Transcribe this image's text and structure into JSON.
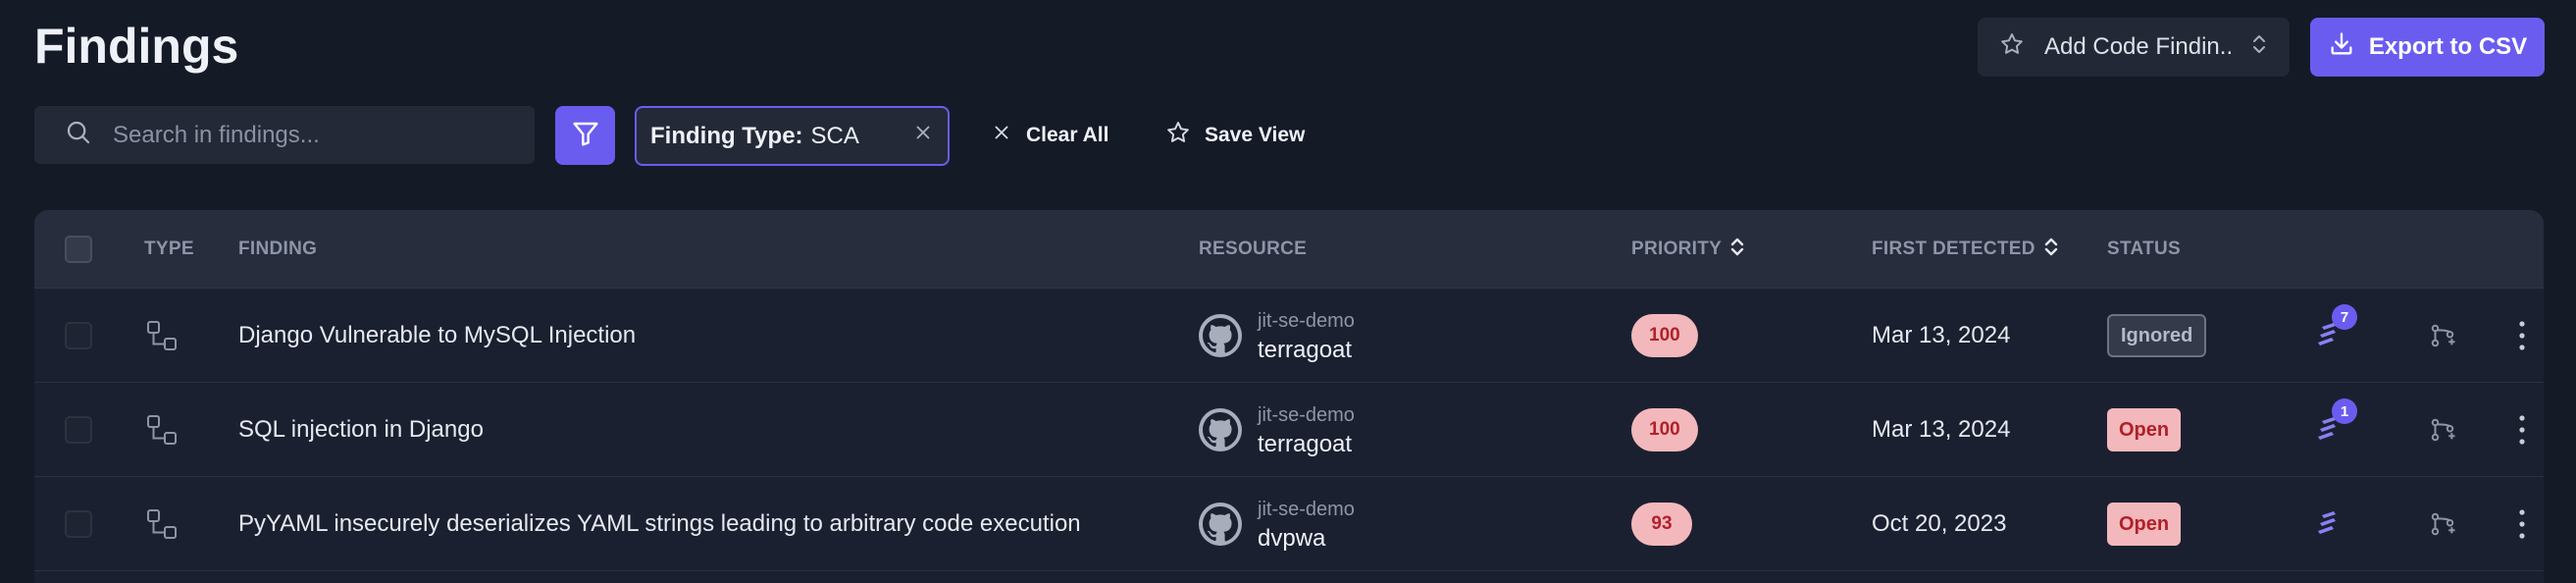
{
  "page": {
    "title": "Findings"
  },
  "toolbar": {
    "add_code_finding_label": "Add Code Findin...",
    "export_label": "Export to CSV"
  },
  "filters": {
    "search_placeholder": "Search in findings...",
    "search_value": "",
    "chip_key": "Finding Type:",
    "chip_value": "SCA",
    "clear_all_label": "Clear All",
    "save_view_label": "Save View"
  },
  "table": {
    "columns": {
      "type": "TYPE",
      "finding": "FINDING",
      "resource": "RESOURCE",
      "priority": "PRIORITY",
      "first_detected": "FIRST DETECTED",
      "status": "STATUS"
    },
    "rows": [
      {
        "finding": "Django Vulnerable to MySQL Injection",
        "org": "jit-se-demo",
        "repo": "terragoat",
        "priority": "100",
        "first_detected": "Mar 13, 2024",
        "status": "Ignored",
        "badge": "7"
      },
      {
        "finding": "SQL injection in Django",
        "org": "jit-se-demo",
        "repo": "terragoat",
        "priority": "100",
        "first_detected": "Mar 13, 2024",
        "status": "Open",
        "badge": "1"
      },
      {
        "finding": "PyYAML insecurely deserializes YAML strings leading to arbitrary code execution",
        "org": "jit-se-demo",
        "repo": "dvpwa",
        "priority": "93",
        "first_detected": "Oct 20, 2023",
        "status": "Open",
        "badge": ""
      }
    ]
  },
  "colors": {
    "background": "#151a27",
    "accent": "#6b5cf0",
    "priority_bg": "#f3b8bb",
    "priority_text": "#b0212b"
  },
  "icons": {
    "add_finding": "star-icon",
    "add_finding_caret": "sort-caret-icon",
    "export": "download-icon",
    "search": "search-icon",
    "filter": "filter-icon",
    "chip_remove": "close-icon",
    "clear_all": "close-icon",
    "save_view": "star-icon",
    "type": "sca-dependency-icon",
    "resource": "github-icon",
    "ai_fix": "jit-ai-icon",
    "create_pr": "git-pr-icon",
    "more": "kebab-menu-icon"
  }
}
